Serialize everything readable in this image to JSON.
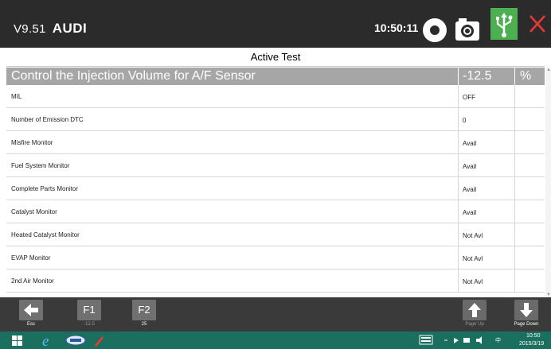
{
  "header": {
    "version": "V9.51",
    "brand": "AUDI",
    "time": "10:50:11"
  },
  "section": {
    "title": "Active Test"
  },
  "pinned": {
    "name": "Control the Injection Volume for A/F Sensor",
    "value": "-12.5",
    "unit": "%"
  },
  "rows": [
    {
      "name": "MIL",
      "value": "OFF"
    },
    {
      "name": "Number of Emission DTC",
      "value": "0"
    },
    {
      "name": "Misfire Monitor",
      "value": "Avail"
    },
    {
      "name": "Fuel System Monitor",
      "value": "Avail"
    },
    {
      "name": "Complete Parts Monitor",
      "value": "Avail"
    },
    {
      "name": "Catalyst Monitor",
      "value": "Avail"
    },
    {
      "name": "Heated Catalyst Monitor",
      "value": "Not Avl"
    },
    {
      "name": "EVAP Monitor",
      "value": "Not Avl"
    },
    {
      "name": "2nd Air Monitor",
      "value": "Not Avl"
    }
  ],
  "fkeys": {
    "esc_label": "Esc",
    "f1": "F1",
    "f1_value": "-12.5",
    "f2": "F2",
    "f2_value": "25",
    "page_up_label": "Page Up",
    "page_down_label": "Page Down"
  },
  "taskbar": {
    "time": "10:50",
    "date": "2015/3/19",
    "ime": "中"
  },
  "colors": {
    "titlebar": "#2b2b2b",
    "pinned_row": "#a6a6a6",
    "usb_accent": "#4caf50",
    "close_accent": "#e53935",
    "taskbar": "#1b6f5e"
  }
}
